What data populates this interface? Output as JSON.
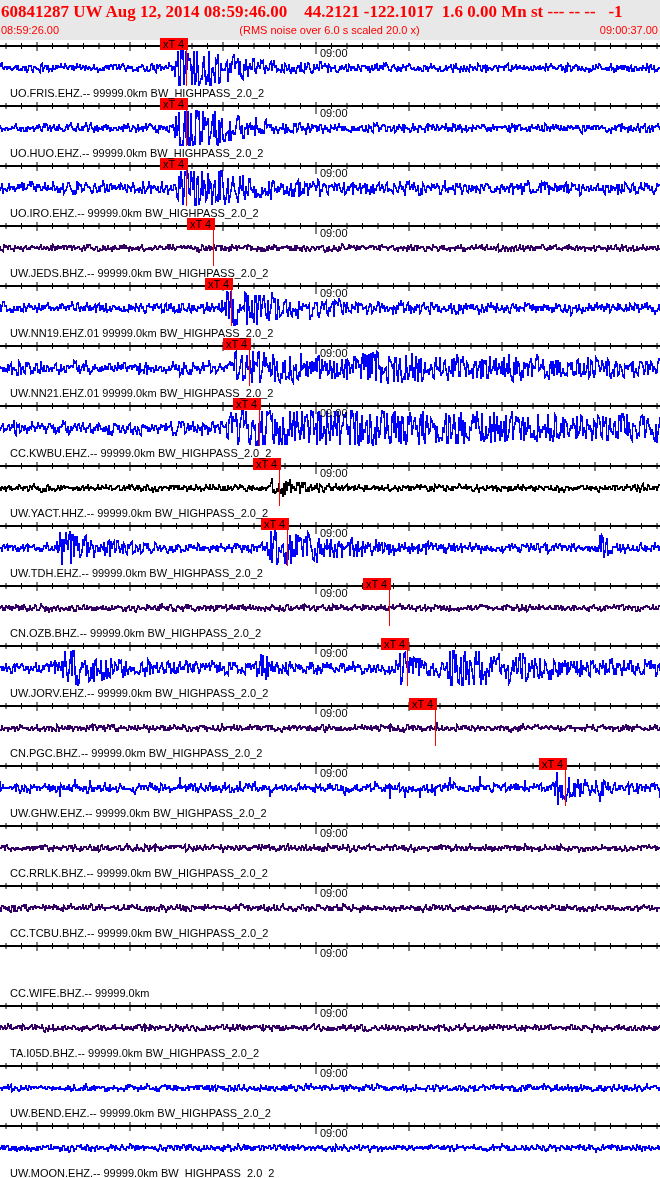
{
  "header": {
    "title": "60841287 UW Aug 12, 2014 08:59:46.00    44.2121 -122.1017  1.6 0.00 Mn st --- -- --   -1",
    "start_time": "08:59:26.00",
    "note": "(RMS noise over 6.0 s scaled 20.0 x)",
    "end_time": "09:00:37.00"
  },
  "traces": [
    {
      "label": "UO.FRIS.EHZ.-- 99999.0km BW_HIGHPASS_2.0_2",
      "time_mark": "09:00",
      "color": "#0000ff",
      "pick": "xT 4"
    },
    {
      "label": "UO.HUO.EHZ.-- 99999.0km BW_HIGHPASS_2.0_2",
      "time_mark": "09:00",
      "color": "#0000ff",
      "pick": "xT 4"
    },
    {
      "label": "UO.IRO.EHZ.-- 99999.0km BW_HIGHPASS_2.0_2",
      "time_mark": "09:00",
      "color": "#0000ff",
      "pick": "xT 4"
    },
    {
      "label": "UW.JEDS.BHZ.-- 99999.0km BW_HIGHPASS_2.0_2",
      "time_mark": "09:00",
      "color": "#330066",
      "pick": "xT 4"
    },
    {
      "label": "UW.NN19.EHZ.01 99999.0km BW_HIGHPASS_2.0_2",
      "time_mark": "09:00",
      "color": "#0000ff",
      "pick": "xT 4"
    },
    {
      "label": "UW.NN21.EHZ.01 99999.0km BW_HIGHPASS_2.0_2",
      "time_mark": "09:00",
      "color": "#0000ff",
      "pick": "xT 4"
    },
    {
      "label": "CC.KWBU.EHZ.-- 99999.0km BW_HIGHPASS_2.0_2",
      "time_mark": "09:00",
      "color": "#0000ff",
      "pick": "xT 4"
    },
    {
      "label": "UW.YACT.HHZ.-- 99999.0km BW_HIGHPASS_2.0_2",
      "time_mark": "09:00",
      "color": "#000000",
      "pick": "xT 4"
    },
    {
      "label": "UW.TDH.EHZ.-- 99999.0km BW_HIGHPASS_2.0_2",
      "time_mark": "09:00",
      "color": "#0000ff",
      "pick": "xT 4"
    },
    {
      "label": "CN.OZB.BHZ.-- 99999.0km BW_HIGHPASS_2.0_2",
      "time_mark": "09:00",
      "color": "#330066",
      "pick": "xT 4"
    },
    {
      "label": "UW.JORV.EHZ.-- 99999.0km BW_HIGHPASS_2.0_2",
      "time_mark": "09:00",
      "color": "#0000ff",
      "pick": "xT 4"
    },
    {
      "label": "CN.PGC.BHZ.-- 99999.0km BW_HIGHPASS_2.0_2",
      "time_mark": "09:00",
      "color": "#330066",
      "pick": "xT 4"
    },
    {
      "label": "UW.GHW.EHZ.-- 99999.0km BW_HIGHPASS_2.0_2",
      "time_mark": "09:00",
      "color": "#0000ff",
      "pick": "xT 4"
    },
    {
      "label": "CC.RRLK.BHZ.-- 99999.0km BW_HIGHPASS_2.0_2",
      "time_mark": "09:00",
      "color": "#330066"
    },
    {
      "label": "CC.TCBU.BHZ.-- 99999.0km BW_HIGHPASS_2.0_2",
      "time_mark": "09:00",
      "color": "#330066"
    },
    {
      "label": "CC.WIFE.BHZ.-- 99999.0km",
      "time_mark": "09:00"
    },
    {
      "label": "TA.I05D.BHZ.-- 99999.0km BW_HIGHPASS_2.0_2",
      "time_mark": "09:00",
      "color": "#330066"
    },
    {
      "label": "UW.BEND.EHZ.-- 99999.0km BW_HIGHPASS_2.0_2",
      "time_mark": "09:00",
      "color": "#0000ff"
    },
    {
      "label": "UW.MOON.EHZ.-- 99999.0km BW_HIGHPASS_2.0_2",
      "time_mark": "09:00",
      "color": "#0000ff"
    }
  ]
}
